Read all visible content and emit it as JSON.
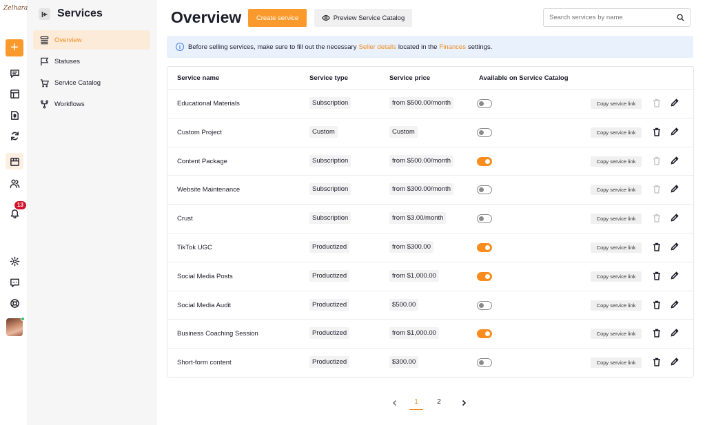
{
  "rail": {
    "logo_text": "Zelhara",
    "notification_count": "13",
    "items": [
      {
        "name": "plus-icon"
      },
      {
        "name": "chat-icon"
      },
      {
        "name": "layout-icon"
      },
      {
        "name": "invoice-icon"
      },
      {
        "name": "refresh-icon"
      },
      {
        "name": "store-icon"
      },
      {
        "name": "users-icon"
      },
      {
        "name": "bell-icon"
      },
      {
        "name": "gear-icon"
      },
      {
        "name": "message-icon"
      },
      {
        "name": "lifebuoy-icon"
      }
    ]
  },
  "sidebar": {
    "title": "Services",
    "items": [
      {
        "label": "Overview",
        "icon": "stack-icon",
        "active": true
      },
      {
        "label": "Statuses",
        "icon": "flag-icon",
        "active": false
      },
      {
        "label": "Service Catalog",
        "icon": "cart-icon",
        "active": false
      },
      {
        "label": "Workflows",
        "icon": "workflow-icon",
        "active": false
      }
    ]
  },
  "header": {
    "title": "Overview",
    "create_label": "Create service",
    "preview_label": "Preview Service Catalog",
    "search_placeholder": "Search services by name"
  },
  "notice": {
    "text_before": "Before selling services, make sure to fill out the necessary ",
    "link1": "Seller details",
    "text_middle": " located in the ",
    "link2": "Finances",
    "text_after": " settings."
  },
  "table": {
    "columns": [
      "Service name",
      "Service type",
      "Service price",
      "Available on Service Catalog"
    ],
    "copy_label": "Copy service link",
    "rows": [
      {
        "name": "Educational Materials",
        "type": "Subscription",
        "price": "from $500.00/month",
        "available": false,
        "deletable": false
      },
      {
        "name": "Custom Project",
        "type": "Custom",
        "price": "Custom",
        "available": false,
        "deletable": true
      },
      {
        "name": "Content Package",
        "type": "Subscription",
        "price": "from $500.00/month",
        "available": true,
        "deletable": false
      },
      {
        "name": "Website Maintenance",
        "type": "Subscription",
        "price": "from $300.00/month",
        "available": false,
        "deletable": false
      },
      {
        "name": "Crust",
        "type": "Subscription",
        "price": "from $3.00/month",
        "available": false,
        "deletable": false
      },
      {
        "name": "TikTok UGC",
        "type": "Productized",
        "price": "from $300.00",
        "available": true,
        "deletable": true
      },
      {
        "name": "Social Media Posts",
        "type": "Productized",
        "price": "from $1,000.00",
        "available": true,
        "deletable": true
      },
      {
        "name": "Social Media Audit",
        "type": "Productized",
        "price": "$500.00",
        "available": false,
        "deletable": true
      },
      {
        "name": "Business Coaching Session",
        "type": "Productized",
        "price": "from $1,000.00",
        "available": true,
        "deletable": true
      },
      {
        "name": "Short-form content",
        "type": "Productized",
        "price": "$300.00",
        "available": false,
        "deletable": true
      }
    ]
  },
  "pagination": {
    "pages": [
      "1",
      "2"
    ],
    "current": "1"
  },
  "colors": {
    "accent": "#fa9a2c",
    "info": "#3d7ee0",
    "badge": "#d0132a"
  }
}
